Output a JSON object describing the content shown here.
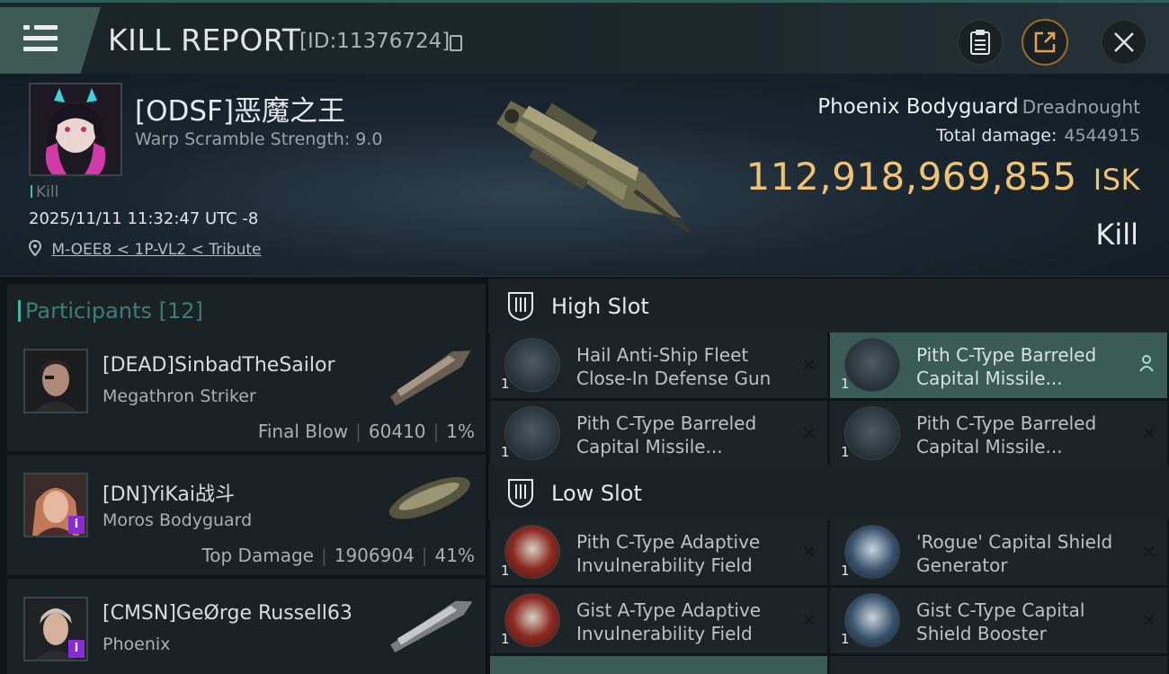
{
  "header": {
    "title": "KILL REPORT",
    "report_id": "[ID:11376724]",
    "icons": [
      "menu-icon",
      "copy-icon",
      "clipboard-icon",
      "share-icon",
      "close-icon"
    ]
  },
  "victim": {
    "pilot_name": "[ODSF]恶魔之王",
    "warp_scramble": "Warp Scramble Strength: 9.0",
    "kill_tag": "Kill",
    "timestamp": "2025/11/11 11:32:47 UTC -8",
    "location": "M-OEE8 < 1P-VL2 < Tribute",
    "ship_name": "Phoenix Bodyguard",
    "ship_class": "Dreadnought",
    "total_damage_label": "Total damage:",
    "total_damage_value": "4544915",
    "isk_value": "112,918,969,855",
    "isk_unit": "ISK",
    "result": "Kill"
  },
  "participants": {
    "label": "Participants",
    "count": "[12]",
    "rows": [
      {
        "name": "[DEAD]SinbadTheSailor",
        "ship": "Megathron Striker",
        "role": "Final Blow",
        "damage": "60410",
        "percent": "1%"
      },
      {
        "name": "[DN]YiKai战斗",
        "ship": "Moros Bodyguard",
        "role": "Top Damage",
        "damage": "1906904",
        "percent": "41%"
      },
      {
        "name": "[CMSN]GeØrge Russell63",
        "ship": "Phoenix",
        "role": "",
        "damage": "",
        "percent": ""
      }
    ]
  },
  "slots": {
    "high": {
      "label": "High Slot",
      "modules": [
        {
          "name": "Hail Anti-Ship Fleet Close-In Defense Gun",
          "display": "Hail Anti-Ship Fleet\nClose-In Defense Gun",
          "qty": "1"
        },
        {
          "name": "Pith C-Type Barreled Capital Missile...",
          "display": "Pith C-Type Barreled\nCapital Missile...",
          "qty": "1"
        },
        {
          "name": "Pith C-Type Barreled Capital Missile...",
          "display": "Pith C-Type Barreled\nCapital Missile...",
          "qty": "1"
        },
        {
          "name": "Pith C-Type Barreled Capital Missile...",
          "display": "Pith C-Type Barreled\nCapital Missile...",
          "qty": "1"
        }
      ]
    },
    "low": {
      "label": "Low Slot",
      "modules": [
        {
          "name": "Pith C-Type Adaptive Invulnerability Field",
          "display": "Pith C-Type Adaptive\nInvulnerability Field",
          "qty": "1"
        },
        {
          "name": "'Rogue' Capital Shield Generator",
          "display": "'Rogue' Capital Shield\nGenerator",
          "qty": "1"
        },
        {
          "name": "Gist A-Type Adaptive Invulnerability Field",
          "display": "Gist A-Type Adaptive\nInvulnerability Field",
          "qty": "1"
        },
        {
          "name": "Gist C-Type Capital Shield Booster",
          "display": "Gist C-Type Capital\nShield Booster",
          "qty": "1"
        }
      ]
    }
  },
  "colors": {
    "accent_teal": "#4bb3a5",
    "isk_gold": "#f0c372",
    "active_module": "#3b5b57"
  }
}
